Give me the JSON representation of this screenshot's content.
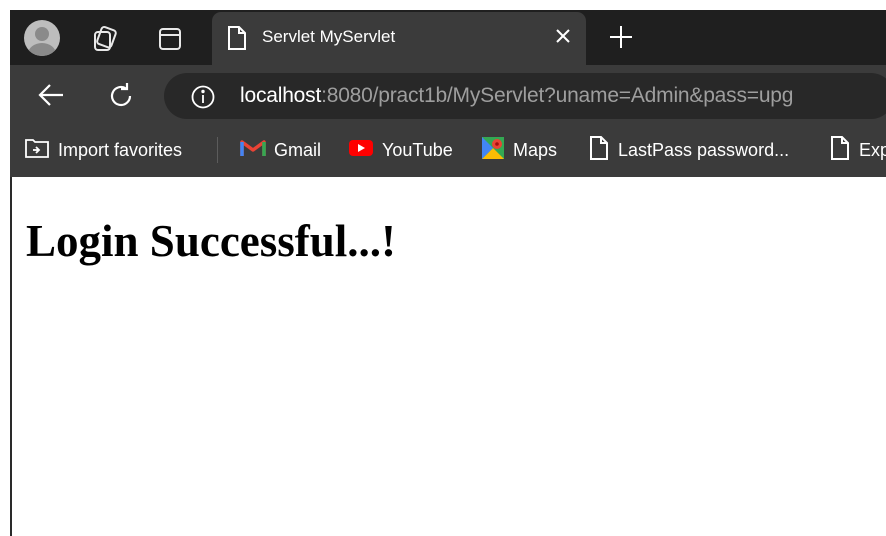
{
  "browser": {
    "tab": {
      "title": "Servlet MyServlet"
    },
    "address_bar": {
      "host": "localhost",
      "path": ":8080/pract1b/MyServlet?uname=Admin&pass=upg"
    },
    "favorites": [
      {
        "label": "Import favorites",
        "icon": "import-favorites-icon"
      },
      {
        "label": "Gmail",
        "icon": "gmail-icon"
      },
      {
        "label": "YouTube",
        "icon": "youtube-icon"
      },
      {
        "label": "Maps",
        "icon": "maps-icon"
      },
      {
        "label": "LastPass password...",
        "icon": "page-icon"
      },
      {
        "label": "Exp",
        "icon": "page-icon"
      }
    ],
    "colors": {
      "chrome_dark": "#1f1f1f",
      "chrome": "#3b3b3b",
      "url_field": "#282828"
    }
  },
  "page": {
    "heading": "Login Successful...!"
  }
}
